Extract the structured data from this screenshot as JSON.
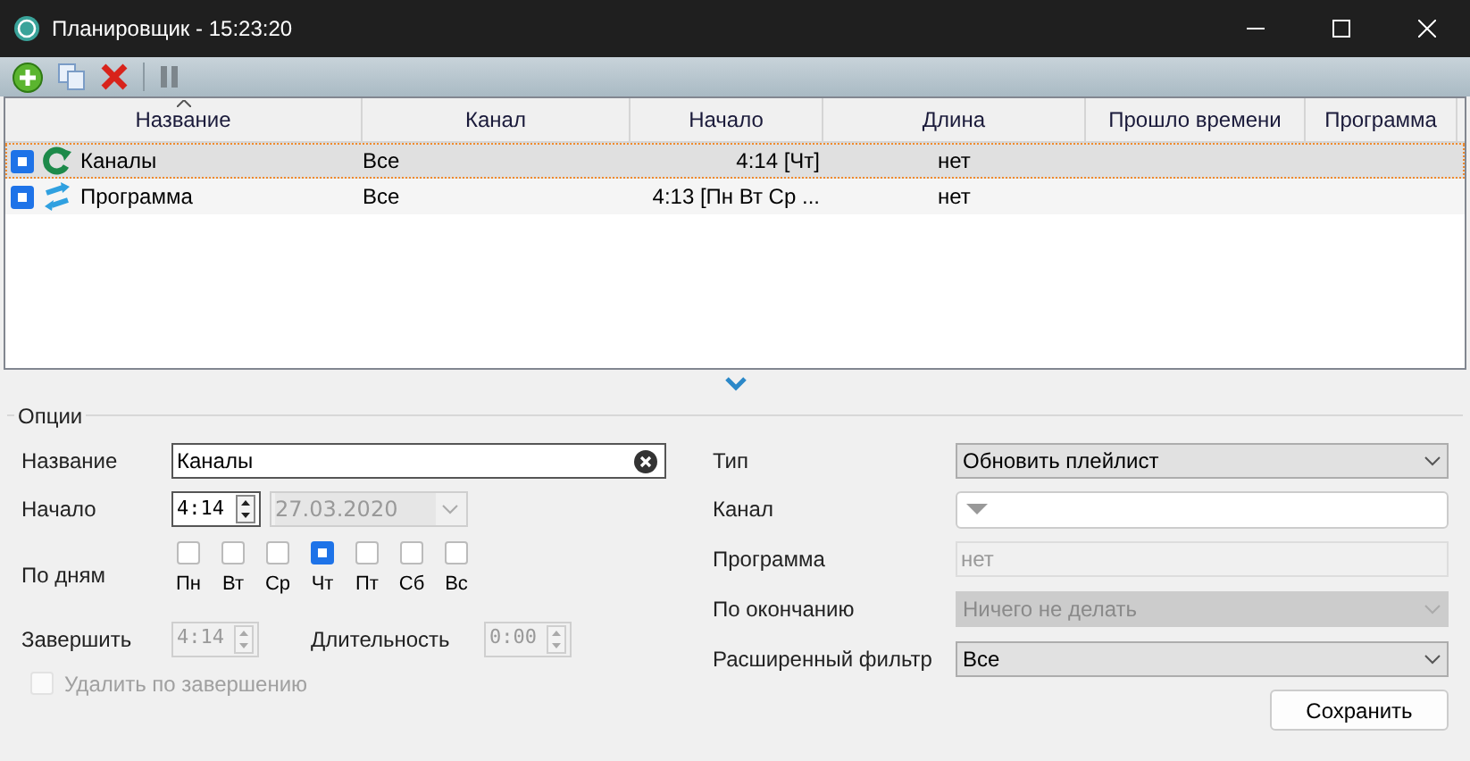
{
  "window": {
    "title": "Планировщик - 15:23:20"
  },
  "table": {
    "columns": [
      {
        "label": "Название",
        "sorted": true
      },
      {
        "label": "Канал",
        "sorted": false
      },
      {
        "label": "Начало",
        "sorted": false
      },
      {
        "label": "Длина",
        "sorted": false
      },
      {
        "label": "Прошло времени",
        "sorted": false
      },
      {
        "label": "Программа",
        "sorted": false
      }
    ],
    "rows": [
      {
        "kind": "refresh",
        "selected": true,
        "checked": true,
        "name": "Каналы",
        "channel": "Все",
        "start": "4:14 [Чт]",
        "length": "нет"
      },
      {
        "kind": "sync",
        "selected": false,
        "checked": true,
        "name": "Программа",
        "channel": "Все",
        "start": "4:13 [Пн Вт Ср ...",
        "length": "нет"
      }
    ]
  },
  "options": {
    "title": "Опции",
    "name": {
      "label": "Название",
      "value": "Каналы"
    },
    "start": {
      "label": "Начало",
      "time": "4:14",
      "date": "27.03.2020"
    },
    "days": {
      "label": "По дням",
      "items": [
        {
          "label": "Пн",
          "checked": false
        },
        {
          "label": "Вт",
          "checked": false
        },
        {
          "label": "Ср",
          "checked": false
        },
        {
          "label": "Чт",
          "checked": true
        },
        {
          "label": "Пт",
          "checked": false
        },
        {
          "label": "Сб",
          "checked": false
        },
        {
          "label": "Вс",
          "checked": false
        }
      ]
    },
    "finish": {
      "label": "Завершить",
      "value": "4:14"
    },
    "duration": {
      "label": "Длительность",
      "value": "0:00"
    },
    "delete_on_finish": {
      "label": "Удалить по завершению",
      "checked": false,
      "disabled": true
    },
    "type": {
      "label": "Тип",
      "value": "Обновить плейлист"
    },
    "channel": {
      "label": "Канал"
    },
    "program": {
      "label": "Программа",
      "value": "нет"
    },
    "on_end": {
      "label": "По окончанию",
      "value": "Ничего не делать"
    },
    "filter": {
      "label": "Расширенный фильтр",
      "value": "Все"
    },
    "save": "Сохранить"
  }
}
